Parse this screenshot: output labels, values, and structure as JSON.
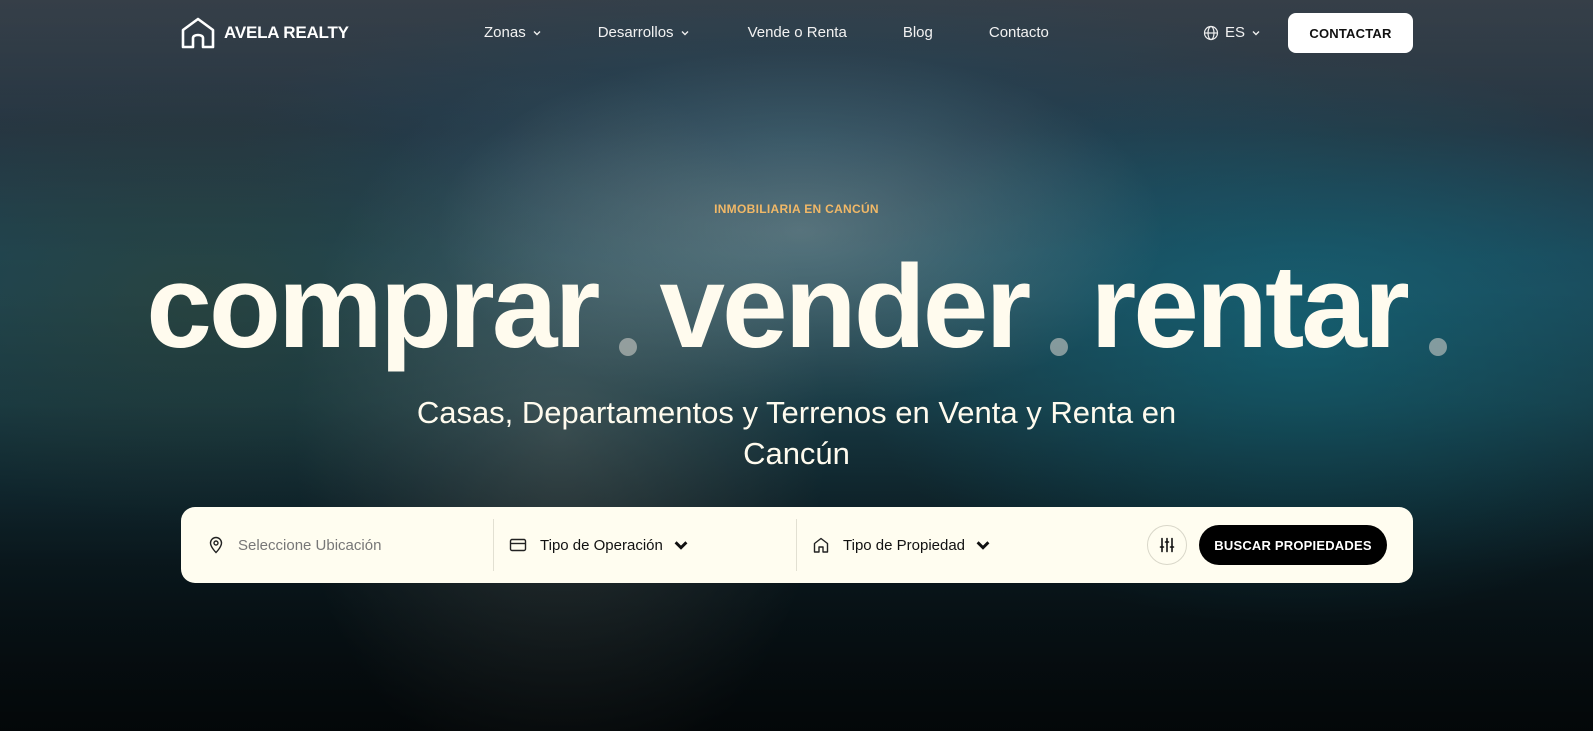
{
  "brand": {
    "name": "AVELA REALTY",
    "logo_icon": "house-outline-icon"
  },
  "nav": {
    "items": [
      {
        "label": "Zonas",
        "has_dropdown": true
      },
      {
        "label": "Desarrollos",
        "has_dropdown": true
      },
      {
        "label": "Vende o Renta",
        "has_dropdown": false
      },
      {
        "label": "Blog",
        "has_dropdown": false
      },
      {
        "label": "Contacto",
        "has_dropdown": false
      }
    ],
    "language": "ES",
    "cta_label": "CONTACTAR"
  },
  "hero": {
    "eyebrow": "INMOBILIARIA EN CANCÚN",
    "words": [
      "comprar",
      "vender",
      "rentar"
    ],
    "subtitle_line1": "Casas, Departamentos y Terrenos en Venta y Renta en",
    "subtitle_line2": "Cancún"
  },
  "search": {
    "location_placeholder": "Seleccione Ubicación",
    "operation_label": "Tipo de Operación",
    "property_label": "Tipo de Propiedad",
    "submit_label": "BUSCAR PROPIEDADES"
  },
  "colors": {
    "eyebrow": "#f1b867",
    "headline": "#fffbee",
    "search_bg": "#fffdf0",
    "button_dark": "#000000"
  }
}
